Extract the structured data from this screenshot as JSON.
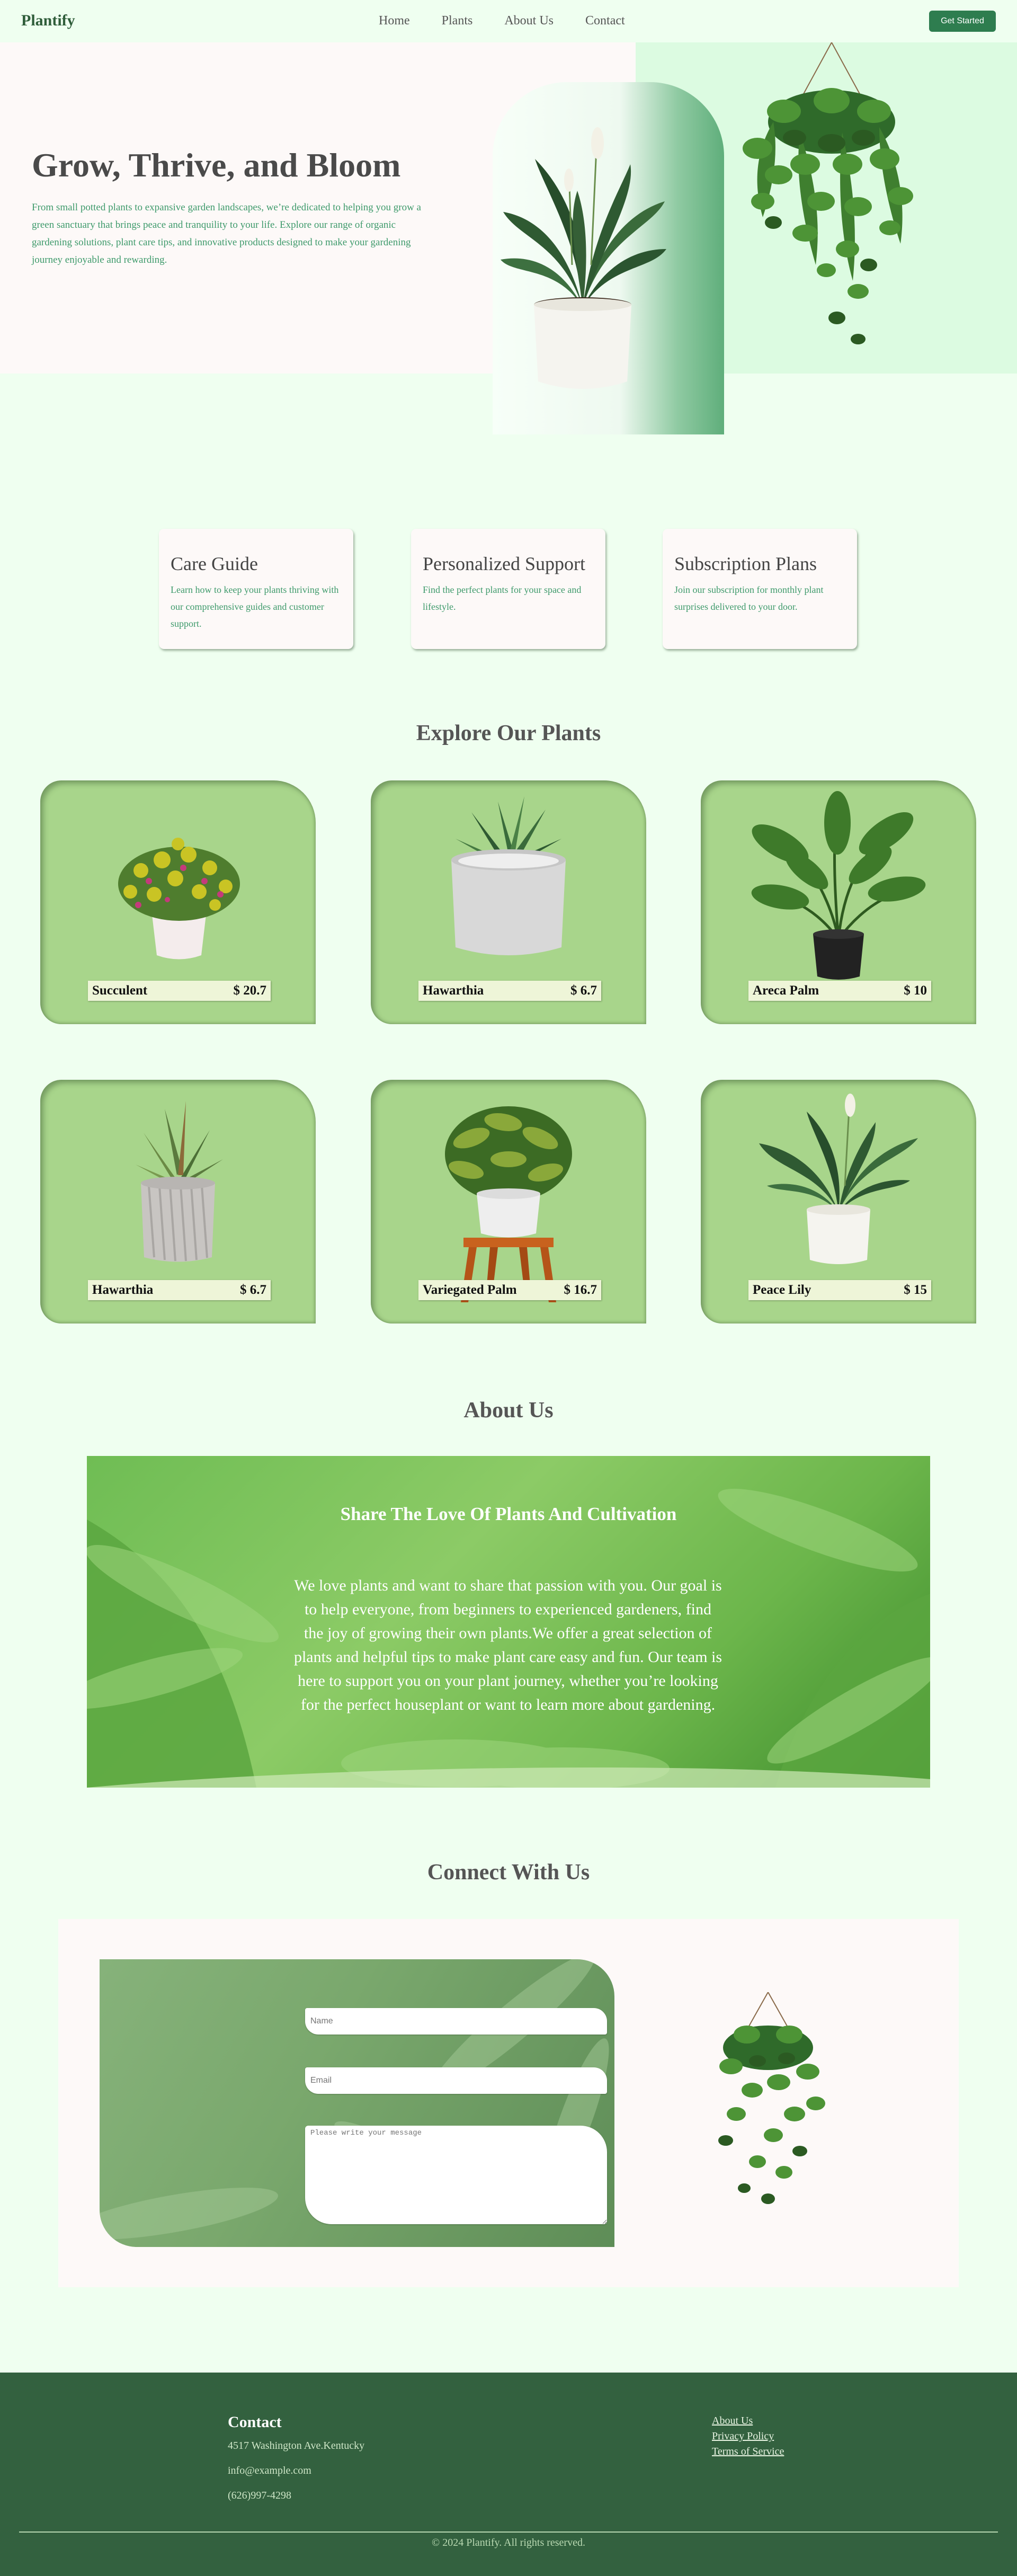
{
  "nav": {
    "brand": "Plantify",
    "links": [
      "Home",
      "Plants",
      "About Us",
      "Contact"
    ],
    "cta": "Get Started"
  },
  "hero": {
    "title": "Grow, Thrive, and Bloom",
    "text": "From small potted plants to expansive garden landscapes, we’re dedicated to helping you grow a green sanctuary that brings peace and tranquility to your life. Explore our range of organic gardening solutions, plant care tips, and innovative products designed to make your gardening journey enjoyable and rewarding."
  },
  "features": [
    {
      "title": "Care Guide",
      "text": "Learn how to keep your plants thriving with our comprehensive guides and customer support."
    },
    {
      "title": "Personalized Support",
      "text": "Find the perfect plants for your space and lifestyle."
    },
    {
      "title": "Subscription Plans",
      "text": "Join our subscription for monthly plant surprises delivered to your door."
    }
  ],
  "explore": {
    "title": "Explore Our Plants",
    "plants": [
      {
        "name": "Succulent",
        "price": "$ 20.7",
        "icon": "flowering-succulent-icon"
      },
      {
        "name": "Hawarthia",
        "price": "$ 6.7",
        "icon": "aloe-in-concrete-pot-icon"
      },
      {
        "name": "Areca Palm",
        "price": "$ 10",
        "icon": "palm-icon"
      },
      {
        "name": "Hawarthia",
        "price": "$ 6.7",
        "icon": "succulent-striped-pot-icon"
      },
      {
        "name": "Variegated Palm",
        "price": "$ 16.7",
        "icon": "schefflera-on-stool-icon"
      },
      {
        "name": "Peace Lily",
        "price": "$ 15",
        "icon": "peace-lily-icon"
      }
    ]
  },
  "about": {
    "title": "About Us",
    "heading": "Share The Love Of Plants And Cultivation",
    "text": "We love plants and want to share that passion with you. Our goal is to help everyone, from beginners to experienced gardeners, find the joy of growing their own plants.We offer a great selection of plants and helpful tips to make plant care easy and fun. Our team is here to support you on your plant journey, whether you’re looking for the perfect houseplant or want to learn more about gardening."
  },
  "connect": {
    "title": "Connect With Us",
    "name_placeholder": "Name",
    "email_placeholder": "Email",
    "message_placeholder": "Please write your message"
  },
  "footer": {
    "title": "Contact",
    "address": "4517 Washington Ave.Kentucky",
    "email": "info@example.com",
    "phone": "(626)997-4298",
    "links": [
      "About Us",
      "Privacy Policy",
      "Terms of Service"
    ],
    "copyright": "© 2024 Plantify. All rights reserved."
  },
  "colors": {
    "page_bg": "#effff0",
    "brand_green": "#2e7d4f",
    "card_green": "#a8d58b",
    "footer_green": "#33613f",
    "accent_text": "#3e9a6b"
  }
}
